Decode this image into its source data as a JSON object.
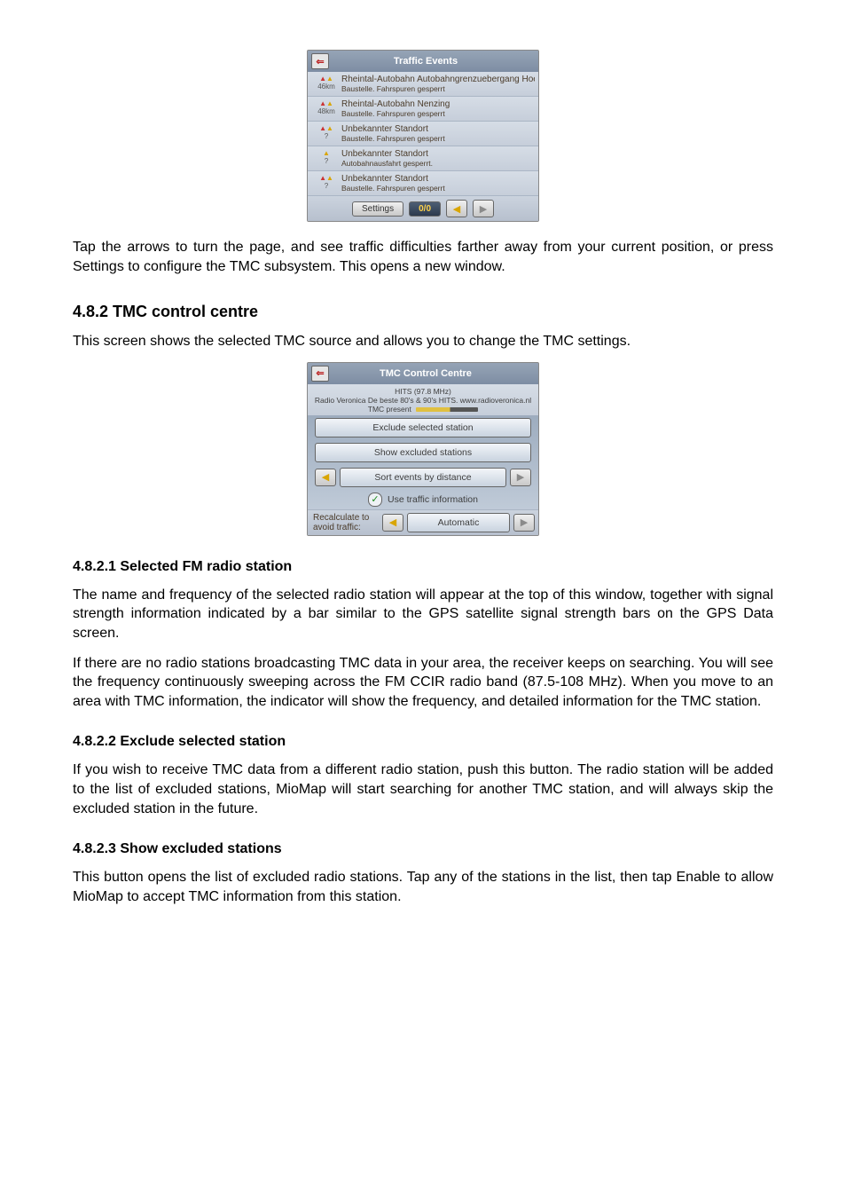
{
  "screenshot1": {
    "title": "Traffic Events",
    "rows": [
      {
        "dist": "46km",
        "icons": "double",
        "title": "Rheintal-Autobahn Autobahngrenzuebergang Hoerbranz",
        "sub": "Baustelle. Fahrspuren gesperrt"
      },
      {
        "dist": "48km",
        "icons": "double",
        "title": "Rheintal-Autobahn Nenzing",
        "sub": "Baustelle. Fahrspuren gesperrt"
      },
      {
        "dist": "?",
        "icons": "double",
        "title": "Unbekannter Standort",
        "sub": "Baustelle. Fahrspuren gesperrt"
      },
      {
        "dist": "?",
        "icons": "single",
        "title": "Unbekannter Standort",
        "sub": "Autobahnausfahrt gesperrt."
      },
      {
        "dist": "?",
        "icons": "double",
        "title": "Unbekannter Standort",
        "sub": "Baustelle. Fahrspuren gesperrt"
      }
    ],
    "settings": "Settings",
    "counter": "0/0"
  },
  "para1": "Tap the arrows to turn the page, and see traffic difficulties farther away from your current position, or press Settings to configure the TMC subsystem. This opens a new window.",
  "h482": "4.8.2  TMC control centre",
  "para2": "This screen shows the selected TMC source and allows you to change the TMC settings.",
  "screenshot2": {
    "title": "TMC Control Centre",
    "info1": "HITS (97.8 MHz)",
    "info2": "Radio Veronica De beste 80's & 90's HITS. www.radioveronica.nl",
    "info3": "TMC present",
    "btn_exclude": "Exclude selected station",
    "btn_showex": "Show excluded stations",
    "btn_sort": "Sort events by distance",
    "btn_useinfo": "Use traffic information",
    "recalc_label": "Recalculate to avoid traffic:",
    "recalc_value": "Automatic"
  },
  "h4821": "4.8.2.1  Selected FM radio station",
  "para3": "The name and frequency of the selected radio station will appear at the top of this window, together with signal strength information indicated by a bar similar to the GPS satellite signal strength bars on the GPS Data screen.",
  "para4": "If there are no radio stations broadcasting TMC data in your area, the receiver keeps on searching. You will see the frequency continuously sweeping across the FM CCIR radio band (87.5-108 MHz). When you move to an area with TMC information, the indicator will show the frequency, and detailed information for the TMC station.",
  "h4822": "4.8.2.2  Exclude selected station",
  "para5": "If you wish to receive TMC data from a different radio station, push this button. The radio station will be added to the list of excluded stations, MioMap will start searching for another TMC station, and will always skip the excluded station in the future.",
  "h4823": "4.8.2.3  Show excluded stations",
  "para6": "This button opens the list of excluded radio stations. Tap any of the stations in the list, then tap Enable to allow MioMap to accept TMC information from this station."
}
